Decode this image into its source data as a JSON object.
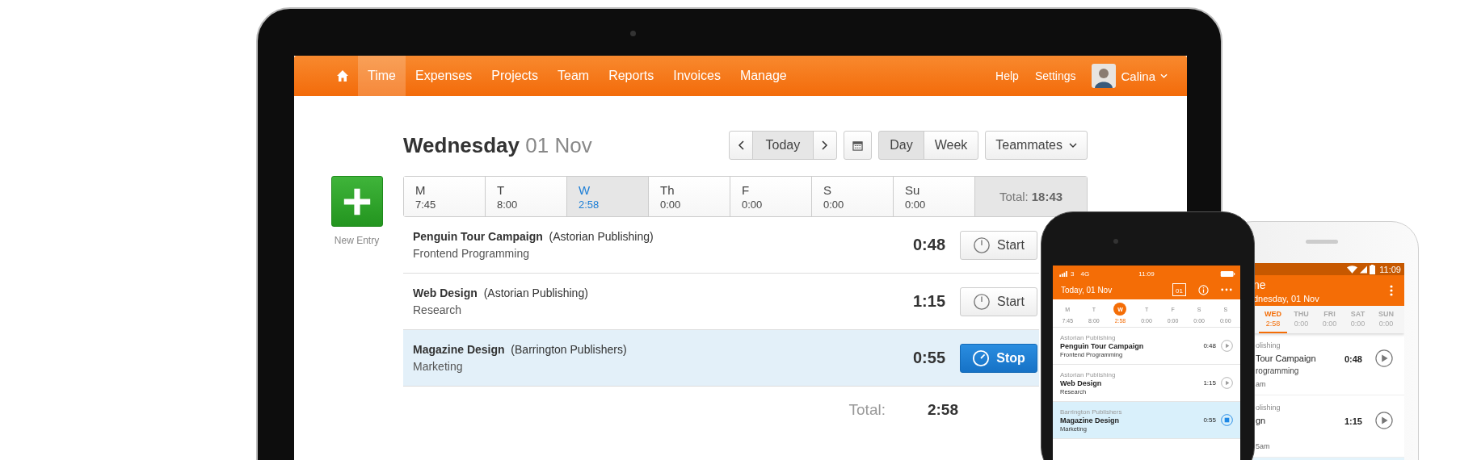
{
  "tablet": {
    "nav": {
      "items": [
        {
          "label": "Time",
          "selected": true
        },
        {
          "label": "Expenses",
          "selected": false
        },
        {
          "label": "Projects",
          "selected": false
        },
        {
          "label": "Team",
          "selected": false
        },
        {
          "label": "Reports",
          "selected": false
        },
        {
          "label": "Invoices",
          "selected": false
        },
        {
          "label": "Manage",
          "selected": false
        }
      ],
      "links": [
        "Help",
        "Settings"
      ],
      "user": "Calina"
    },
    "heading": {
      "weekday": "Wednesday",
      "date": "01 Nov"
    },
    "toolbar": {
      "today": "Today",
      "views": [
        {
          "label": "Day",
          "selected": true
        },
        {
          "label": "Week",
          "selected": false
        }
      ],
      "teammates": "Teammates"
    },
    "new_entry": "New Entry",
    "week": {
      "days": [
        {
          "label": "M",
          "hours": "7:45",
          "selected": false
        },
        {
          "label": "T",
          "hours": "8:00",
          "selected": false
        },
        {
          "label": "W",
          "hours": "2:58",
          "selected": true
        },
        {
          "label": "Th",
          "hours": "0:00",
          "selected": false
        },
        {
          "label": "F",
          "hours": "0:00",
          "selected": false
        },
        {
          "label": "S",
          "hours": "0:00",
          "selected": false
        },
        {
          "label": "Su",
          "hours": "0:00",
          "selected": false
        }
      ],
      "total_label": "Total:",
      "total": "18:43"
    },
    "entries": [
      {
        "project": "Penguin Tour Campaign",
        "client": "(Astorian Publishing)",
        "task": "Frontend Programming",
        "duration": "0:48",
        "running": false,
        "button": "Start"
      },
      {
        "project": "Web Design",
        "client": "(Astorian Publishing)",
        "task": "Research",
        "duration": "1:15",
        "running": false,
        "button": "Start"
      },
      {
        "project": "Magazine Design",
        "client": "(Barrington Publishers)",
        "task": "Marketing",
        "duration": "0:55",
        "running": true,
        "button": "Stop"
      }
    ],
    "total": {
      "label": "Total:",
      "value": "2:58"
    }
  },
  "iphone": {
    "status": {
      "carrier": "3",
      "network": "4G",
      "time": "11:09"
    },
    "title": "Today, 01 Nov",
    "calendar_day": "01",
    "days": [
      {
        "label": "M",
        "hours": "7:45",
        "selected": false
      },
      {
        "label": "T",
        "hours": "8:00",
        "selected": false
      },
      {
        "label": "W",
        "hours": "2:58",
        "selected": true
      },
      {
        "label": "T",
        "hours": "0:00",
        "selected": false
      },
      {
        "label": "F",
        "hours": "0:00",
        "selected": false
      },
      {
        "label": "S",
        "hours": "0:00",
        "selected": false
      },
      {
        "label": "S",
        "hours": "0:00",
        "selected": false
      }
    ],
    "entries": [
      {
        "client": "Astorian Publishing",
        "project": "Penguin Tour Campaign",
        "task": "Frontend Programming",
        "duration": "0:48",
        "running": false
      },
      {
        "client": "Astorian Publishing",
        "project": "Web Design",
        "task": "Research",
        "duration": "1:15",
        "running": false
      },
      {
        "client": "Barrington Publishers",
        "project": "Magazine Design",
        "task": "Marketing",
        "duration": "0:55",
        "running": true
      }
    ]
  },
  "android": {
    "status": {
      "time": "11:09"
    },
    "title": "ne",
    "subtitle": "dnesday, 01 Nov",
    "days": [
      {
        "label": "WED",
        "hours": "2:58",
        "selected": true
      },
      {
        "label": "THU",
        "hours": "0:00",
        "selected": false
      },
      {
        "label": "FRI",
        "hours": "0:00",
        "selected": false
      },
      {
        "label": "SAT",
        "hours": "0:00",
        "selected": false
      },
      {
        "label": "SUN",
        "hours": "0:00",
        "selected": false
      }
    ],
    "entries": [
      {
        "client": "olishing",
        "project": "Tour Campaign",
        "task": "rogramming",
        "time": "am",
        "duration": "0:48"
      },
      {
        "client": "olishing",
        "project": "gn",
        "time": "5am",
        "duration": "1:15"
      }
    ]
  }
}
